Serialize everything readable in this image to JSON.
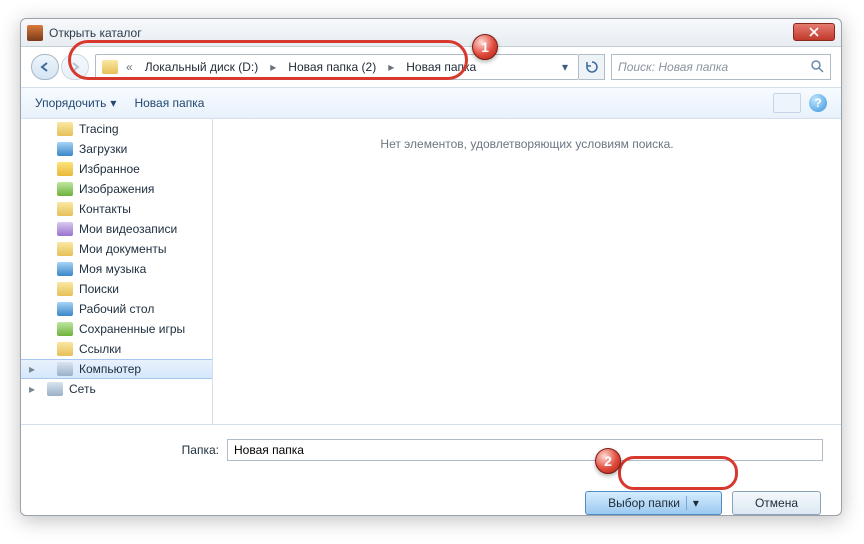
{
  "title": "Открыть каталог",
  "breadcrumb": {
    "overflow": "«",
    "segments": [
      "Локальный диск (D:)",
      "Новая папка (2)",
      "Новая папка"
    ]
  },
  "search": {
    "placeholder": "Поиск: Новая папка"
  },
  "toolbar": {
    "organize": "Упорядочить",
    "new_folder": "Новая папка",
    "help_glyph": "?"
  },
  "tree": [
    {
      "label": "Tracing",
      "icon": "folder"
    },
    {
      "label": "Загрузки",
      "icon": "blue"
    },
    {
      "label": "Избранное",
      "icon": "star"
    },
    {
      "label": "Изображения",
      "icon": "green"
    },
    {
      "label": "Контакты",
      "icon": "folder"
    },
    {
      "label": "Мои видеозаписи",
      "icon": "purple"
    },
    {
      "label": "Мои документы",
      "icon": "folder"
    },
    {
      "label": "Моя музыка",
      "icon": "blue"
    },
    {
      "label": "Поиски",
      "icon": "folder"
    },
    {
      "label": "Рабочий стол",
      "icon": "blue"
    },
    {
      "label": "Сохраненные игры",
      "icon": "green"
    },
    {
      "label": "Ссылки",
      "icon": "folder"
    },
    {
      "label": "Компьютер",
      "icon": "pc",
      "selected": true,
      "expandable": true,
      "level": 0
    },
    {
      "label": "Сеть",
      "icon": "pc",
      "expandable": true,
      "level": 0
    }
  ],
  "content": {
    "empty_message": "Нет элементов, удовлетворяющих условиям поиска."
  },
  "footer": {
    "folder_label": "Папка:",
    "folder_value": "Новая папка",
    "select_button": "Выбор папки",
    "cancel_button": "Отмена"
  },
  "markers": {
    "one": "1",
    "two": "2"
  }
}
